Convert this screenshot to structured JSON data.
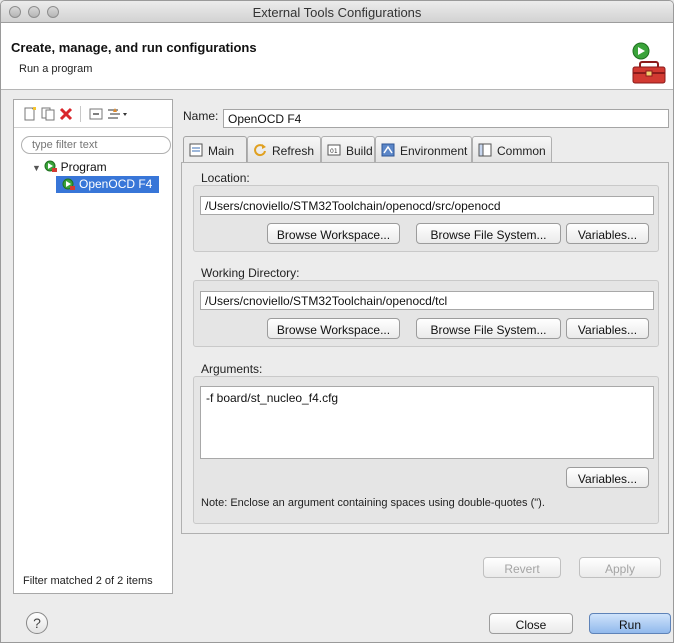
{
  "window": {
    "title": "External Tools Configurations"
  },
  "banner": {
    "title": "Create, manage, and run configurations",
    "subtitle": "Run a program"
  },
  "left_panel": {
    "toolbar_icons": [
      "new-config-icon",
      "duplicate-icon",
      "delete-icon",
      "collapse-all-icon",
      "filter-icon"
    ],
    "filter_placeholder": "type filter text",
    "tree": {
      "category": "Program",
      "selected_item": "OpenOCD F4"
    },
    "status": "Filter matched 2 of 2 items"
  },
  "name": {
    "label": "Name:",
    "value": "OpenOCD F4"
  },
  "tabs": [
    {
      "label": "Main",
      "icon": "main-tab-icon",
      "active": true
    },
    {
      "label": "Refresh",
      "icon": "refresh-icon",
      "active": false
    },
    {
      "label": "Build",
      "icon": "build-icon",
      "active": false
    },
    {
      "label": "Environment",
      "icon": "environment-icon",
      "active": false
    },
    {
      "label": "Common",
      "icon": "common-icon",
      "active": false
    }
  ],
  "location": {
    "label": "Location:",
    "value": "/Users/cnoviello/STM32Toolchain/openocd/src/openocd",
    "browse_workspace": "Browse Workspace...",
    "browse_fs": "Browse File System...",
    "variables": "Variables..."
  },
  "working_dir": {
    "label": "Working Directory:",
    "value": "/Users/cnoviello/STM32Toolchain/openocd/tcl",
    "browse_workspace": "Browse Workspace...",
    "browse_fs": "Browse File System...",
    "variables": "Variables..."
  },
  "arguments": {
    "label": "Arguments:",
    "value": "-f board/st_nucleo_f4.cfg",
    "variables": "Variables...",
    "note": "Note: Enclose an argument containing spaces using double-quotes (\")."
  },
  "footer": {
    "revert": "Revert",
    "apply": "Apply",
    "close": "Close",
    "run": "Run",
    "help": "?"
  },
  "colors": {
    "selection": "#3876d8",
    "default_button": "#91b9ec",
    "delete_icon": "#d9262b"
  }
}
